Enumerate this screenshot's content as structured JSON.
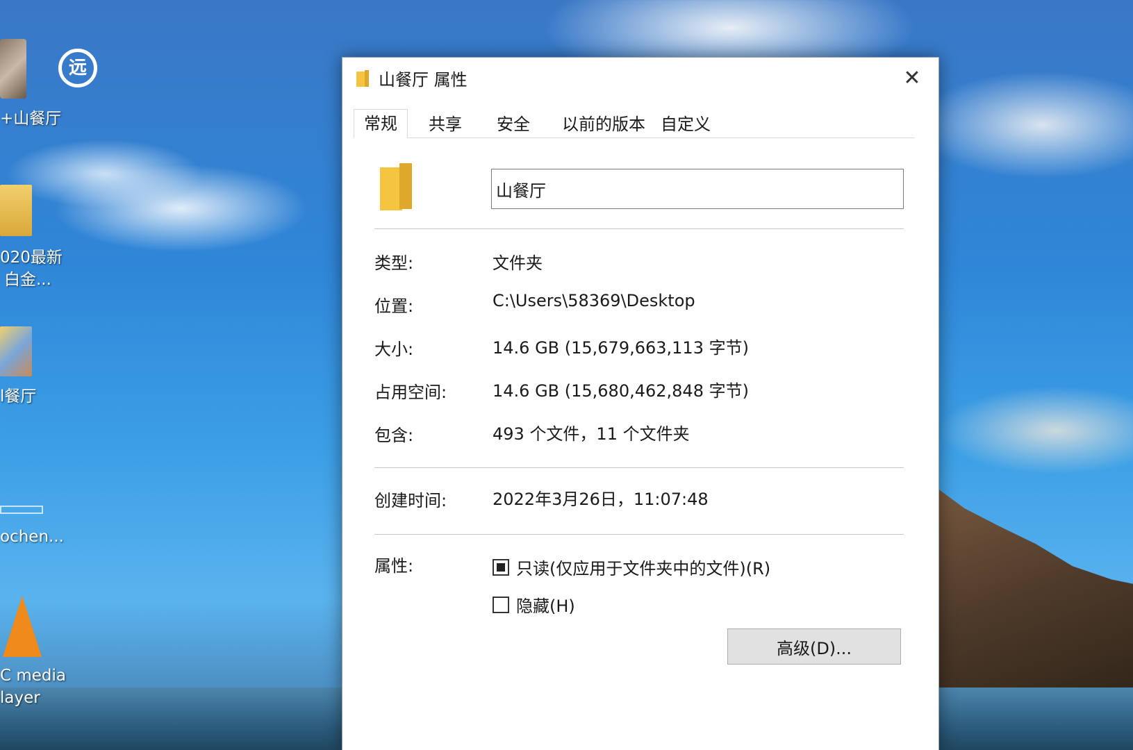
{
  "desktop": {
    "icons": [
      {
        "label": "+山餐厅"
      },
      {
        "label": "020最新"
      },
      {
        "label": "白金..."
      },
      {
        "label": "l餐厅"
      },
      {
        "label": "ochen..."
      },
      {
        "label": "C media"
      },
      {
        "label": "layer"
      }
    ]
  },
  "dialog": {
    "title": "山餐厅 属性",
    "close_label": "✕",
    "tabs": [
      {
        "label": "常规",
        "active": true
      },
      {
        "label": "共享"
      },
      {
        "label": "安全"
      },
      {
        "label": "以前的版本"
      },
      {
        "label": "自定义"
      }
    ],
    "name_value": "山餐厅",
    "properties": [
      {
        "label": "类型:",
        "value": "文件夹"
      },
      {
        "label": "位置:",
        "value": "C:\\Users\\58369\\Desktop"
      },
      {
        "label": "大小:",
        "value": "14.6 GB (15,679,663,113 字节)"
      },
      {
        "label": "占用空间:",
        "value": "14.6 GB (15,680,462,848 字节)"
      },
      {
        "label": "包含:",
        "value": "493 个文件，11 个文件夹"
      }
    ],
    "created": {
      "label": "创建时间:",
      "value": "2022年3月26日，11:07:48"
    },
    "attributes": {
      "label": "属性:",
      "readonly_label": "只读(仅应用于文件夹中的文件)(R)",
      "readonly_checked": true,
      "hidden_label": "隐藏(H)",
      "hidden_checked": false,
      "advanced_button": "高级(D)..."
    }
  },
  "colors": {
    "folder": "#f5c542",
    "folder_dark": "#e0a82a"
  }
}
